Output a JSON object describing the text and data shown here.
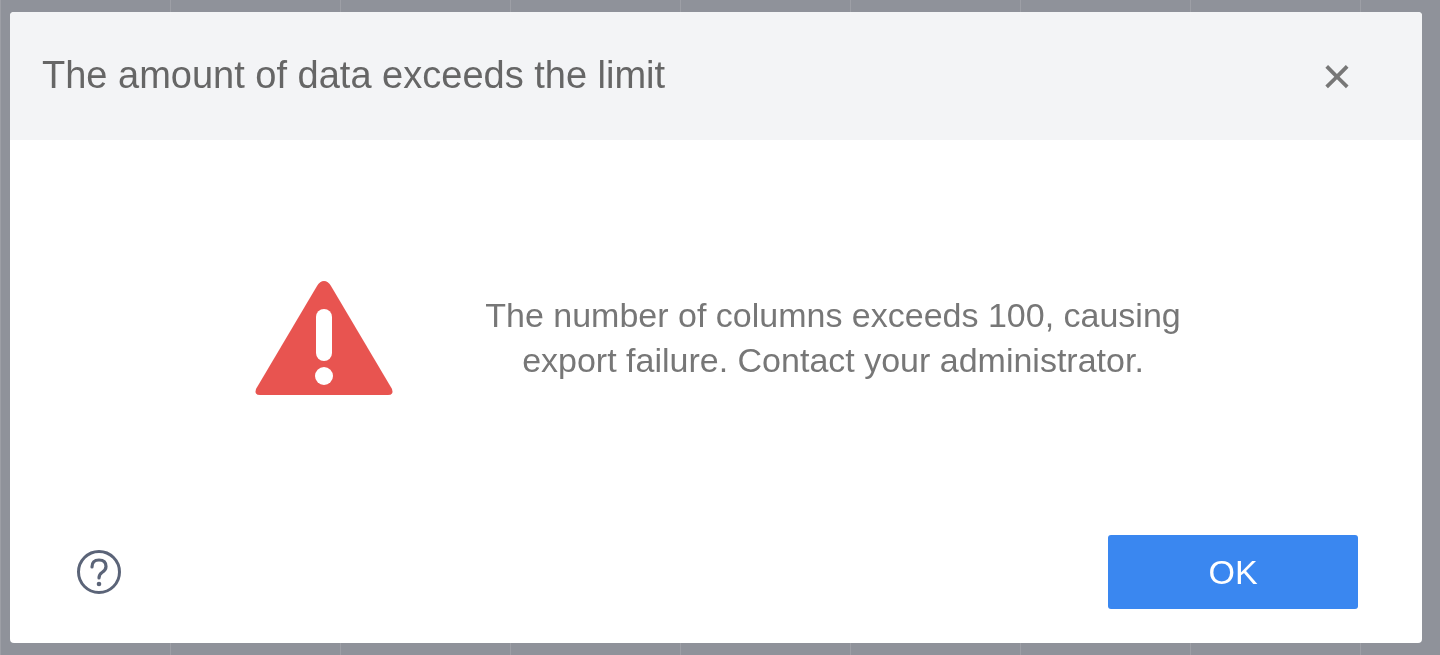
{
  "dialog": {
    "title": "The amount of data exceeds the limit",
    "close": "×",
    "message": "The number of columns exceeds 100, causing export failure. Contact your administrator.",
    "buttons": [
      "OK"
    ]
  }
}
